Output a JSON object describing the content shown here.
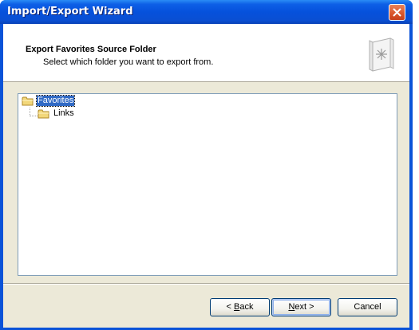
{
  "window": {
    "title": "Import/Export Wizard"
  },
  "header": {
    "title": "Export Favorites Source Folder",
    "subtitle": "Select which folder you want to export from."
  },
  "tree": {
    "items": [
      {
        "label": "Favorites",
        "icon": "folder-icon",
        "selected": true
      },
      {
        "label": "Links",
        "icon": "folder-icon",
        "selected": false
      }
    ]
  },
  "buttons": {
    "back": {
      "prefix": "< ",
      "mnemonic": "B",
      "rest": "ack"
    },
    "next": {
      "mnemonic": "N",
      "rest": "ext >"
    },
    "cancel": "Cancel"
  },
  "colors": {
    "titlebar": "#0a53d8",
    "selection": "#316ac5",
    "close_button": "#d9552a",
    "dialog_face": "#ece9d8"
  }
}
